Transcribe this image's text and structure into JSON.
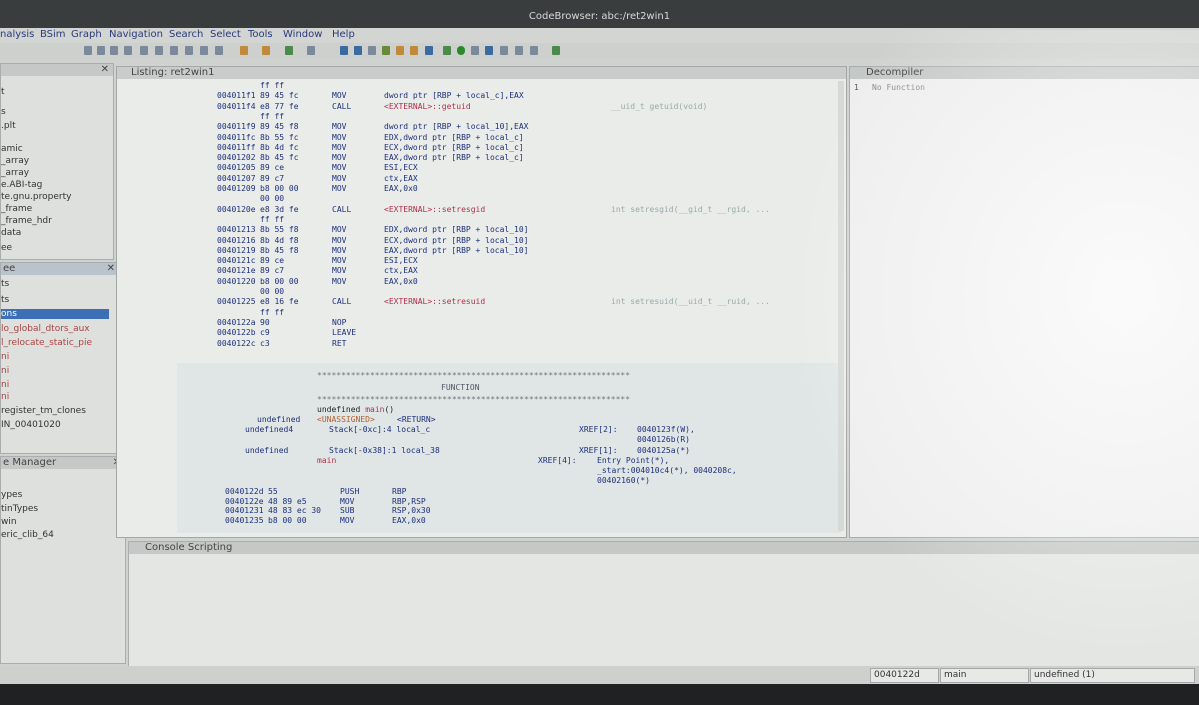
{
  "window": {
    "title": "CodeBrowser: abc:/ret2win1"
  },
  "menu": [
    "nalysis",
    "BSim",
    "Graph",
    "Navigation",
    "Search",
    "Select",
    "Tools",
    "Window",
    "Help"
  ],
  "left_tree": [
    "t",
    "s",
    ".plt",
    "amic",
    "_array",
    "_array",
    "e.ABI-tag",
    "te.gnu.property",
    "_frame",
    "_frame_hdr",
    "data",
    "ee"
  ],
  "symbol_tree": {
    "header": "ee",
    "items": [
      "ts",
      "ts",
      "ons",
      "lo_global_dtors_aux",
      "l_relocate_static_pie",
      "ni",
      "ni",
      "ni",
      "ni",
      "register_tm_clones",
      "IN_00401020"
    ]
  },
  "data_types": {
    "header": "e Manager",
    "items": [
      "ypes",
      "tinTypes",
      "win",
      "eric_clib_64"
    ]
  },
  "listing": {
    "title": "Listing: ret2win1",
    "rows1": [
      {
        "addr": "",
        "bytes": "ff ff",
        "mnem": "",
        "ops": "",
        "red": false
      },
      {
        "addr": "004011f1",
        "bytes": "89 45 fc",
        "mnem": "MOV",
        "ops": "dword ptr [RBP + local_c],EAX",
        "red": false
      },
      {
        "addr": "004011f4",
        "bytes": "e8 77 fe",
        "mnem": "CALL",
        "ops": "<EXTERNAL>::getuid",
        "red": true
      },
      {
        "addr": "",
        "bytes": "ff ff",
        "mnem": "",
        "ops": "",
        "red": false
      },
      {
        "addr": "004011f9",
        "bytes": "89 45 f8",
        "mnem": "MOV",
        "ops": "dword ptr [RBP + local_10],EAX",
        "red": false
      },
      {
        "addr": "004011fc",
        "bytes": "8b 55 fc",
        "mnem": "MOV",
        "ops": "EDX,dword ptr [RBP + local_c]",
        "red": false
      },
      {
        "addr": "004011ff",
        "bytes": "8b 4d fc",
        "mnem": "MOV",
        "ops": "ECX,dword ptr [RBP + local_c]",
        "red": false
      },
      {
        "addr": "00401202",
        "bytes": "8b 45 fc",
        "mnem": "MOV",
        "ops": "EAX,dword ptr [RBP + local_c]",
        "red": false
      },
      {
        "addr": "00401205",
        "bytes": "89 ce",
        "mnem": "MOV",
        "ops": "ESI,ECX",
        "red": false
      },
      {
        "addr": "00401207",
        "bytes": "89 c7",
        "mnem": "MOV",
        "ops": "ctx,EAX",
        "red": false
      },
      {
        "addr": "00401209",
        "bytes": "b8 00 00",
        "mnem": "MOV",
        "ops": "EAX,0x0",
        "red": false
      },
      {
        "addr": "",
        "bytes": "00 00",
        "mnem": "",
        "ops": "",
        "red": false
      },
      {
        "addr": "0040120e",
        "bytes": "e8 3d fe",
        "mnem": "CALL",
        "ops": "<EXTERNAL>::setresgid",
        "red": true
      },
      {
        "addr": "",
        "bytes": "ff ff",
        "mnem": "",
        "ops": "",
        "red": false
      },
      {
        "addr": "00401213",
        "bytes": "8b 55 f8",
        "mnem": "MOV",
        "ops": "EDX,dword ptr [RBP + local_10]",
        "red": false
      },
      {
        "addr": "00401216",
        "bytes": "8b 4d f8",
        "mnem": "MOV",
        "ops": "ECX,dword ptr [RBP + local_10]",
        "red": false
      },
      {
        "addr": "00401219",
        "bytes": "8b 45 f8",
        "mnem": "MOV",
        "ops": "EAX,dword ptr [RBP + local_10]",
        "red": false
      },
      {
        "addr": "0040121c",
        "bytes": "89 ce",
        "mnem": "MOV",
        "ops": "ESI,ECX",
        "red": false
      },
      {
        "addr": "0040121e",
        "bytes": "89 c7",
        "mnem": "MOV",
        "ops": "ctx,EAX",
        "red": false
      },
      {
        "addr": "00401220",
        "bytes": "b8 00 00",
        "mnem": "MOV",
        "ops": "EAX,0x0",
        "red": false
      },
      {
        "addr": "",
        "bytes": "00 00",
        "mnem": "",
        "ops": "",
        "red": false
      },
      {
        "addr": "00401225",
        "bytes": "e8 16 fe",
        "mnem": "CALL",
        "ops": "<EXTERNAL>::setresuid",
        "red": true
      },
      {
        "addr": "",
        "bytes": "ff ff",
        "mnem": "",
        "ops": "",
        "red": false
      },
      {
        "addr": "0040122a",
        "bytes": "90",
        "mnem": "NOP",
        "ops": "",
        "red": false
      },
      {
        "addr": "0040122b",
        "bytes": "c9",
        "mnem": "LEAVE",
        "ops": "",
        "red": false
      },
      {
        "addr": "0040122c",
        "bytes": "c3",
        "mnem": "RET",
        "ops": "",
        "red": false
      }
    ],
    "comments": [
      "__uid_t getuid(void)",
      "int setresgid(__gid_t __rgid, ...",
      "int setresuid(__uid_t __ruid, ..."
    ],
    "func_banner": "FUNCTION",
    "sig_type": "undefined",
    "sig_name": "main",
    "sig_paren": "()",
    "vars": [
      {
        "type": "undefined",
        "loc": "<UNASSIGNED>",
        "name": "<RETURN>"
      },
      {
        "type": "undefined4",
        "loc": "Stack[-0xc]:4 local_c",
        "xref_label": "XREF[2]:",
        "xrefs": [
          "0040123f(W),",
          "0040126b(R)"
        ]
      },
      {
        "type": "undefined",
        "loc": "Stack[-0x38]:1 local_38",
        "xref_label": "XREF[1]:",
        "xrefs": [
          "0040125a(*)"
        ]
      }
    ],
    "label": "main",
    "entry_xref": {
      "label": "XREF[4]:",
      "lines": [
        "Entry Point(*),",
        "_start:004010c4(*), 0040208c,",
        "00402160(*)"
      ]
    },
    "rows2": [
      {
        "addr": "0040122d",
        "bytes": "55",
        "mnem": "PUSH",
        "ops": "RBP"
      },
      {
        "addr": "0040122e",
        "bytes": "48 89 e5",
        "mnem": "MOV",
        "ops": "RBP,RSP"
      },
      {
        "addr": "00401231",
        "bytes": "48 83 ec 30",
        "mnem": "SUB",
        "ops": "RSP,0x30"
      },
      {
        "addr": "00401235",
        "bytes": "b8 00 00",
        "mnem": "MOV",
        "ops": "EAX,0x0"
      }
    ]
  },
  "decompiler": {
    "title": "Decompiler",
    "line_no": "1",
    "text": "No Function"
  },
  "console": {
    "title": "Console   Scripting"
  },
  "status": {
    "address": "0040122d",
    "function": "main",
    "type": "undefined (1)"
  }
}
